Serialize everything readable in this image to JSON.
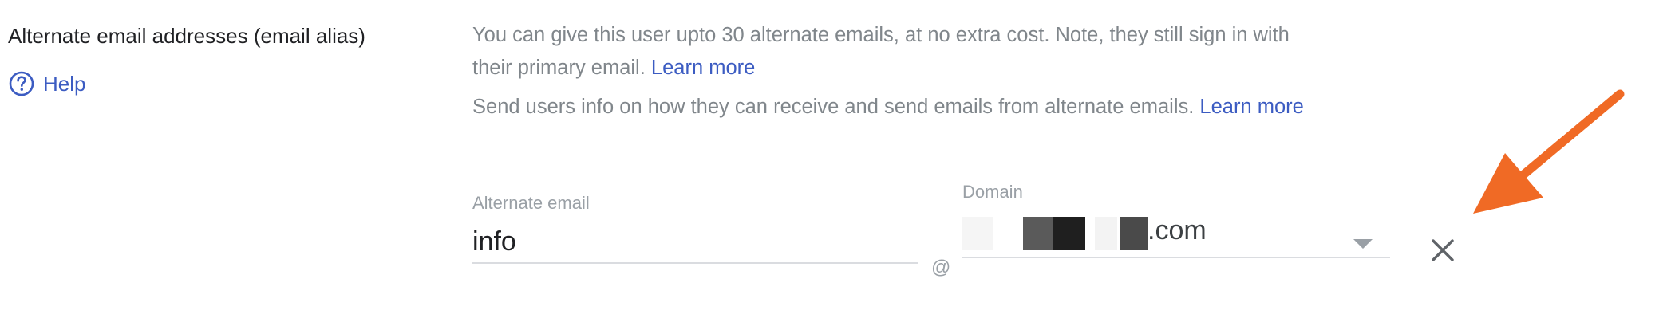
{
  "section": {
    "label": "Alternate email addresses (email alias)",
    "help_label": "Help"
  },
  "description": {
    "line1": "You can give this user upto 30 alternate emails, at no extra cost. Note, they still sign in with",
    "line2_prefix": "their primary email.",
    "line2_link": "Learn more",
    "line3_prefix": "Send users info on how they can receive and send emails from alternate emails.",
    "line3_link": "Learn more"
  },
  "alternate_email": {
    "label": "Alternate email",
    "value": "info"
  },
  "at_symbol": "@",
  "domain": {
    "label": "Domain",
    "value_suffix": ".com",
    "redacted": true
  },
  "icons": {
    "help": "help-circle-icon",
    "dropdown": "dropdown-arrow-icon",
    "remove": "close-icon",
    "annotation": "annotation-arrow"
  },
  "colors": {
    "link": "#3c5cc2",
    "annotation_arrow": "#f06a25",
    "muted_text": "#80868b",
    "body_text": "#202124"
  }
}
